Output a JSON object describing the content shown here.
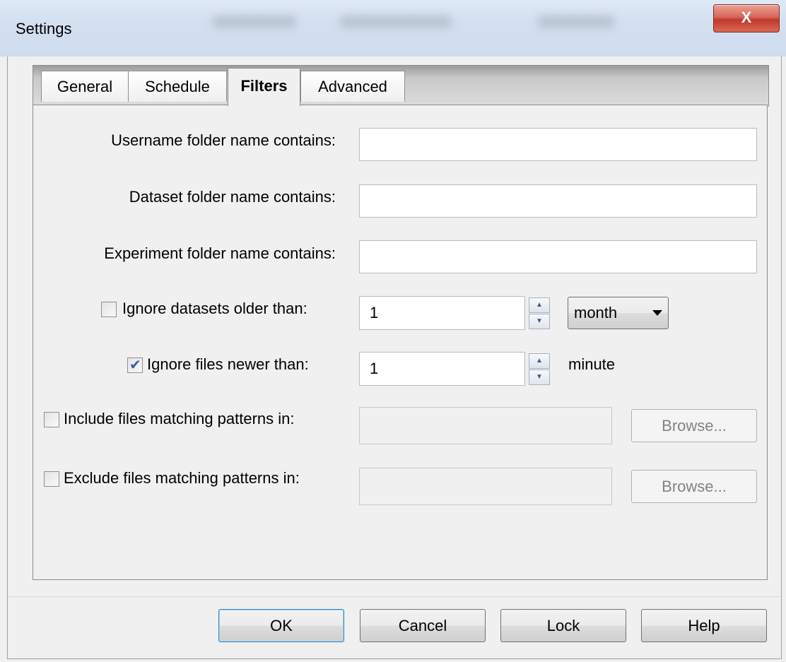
{
  "window": {
    "title": "Settings",
    "close_glyph": "X"
  },
  "tabs": [
    {
      "label": "General",
      "active": false
    },
    {
      "label": "Schedule",
      "active": false
    },
    {
      "label": "Filters",
      "active": true
    },
    {
      "label": "Advanced",
      "active": false
    }
  ],
  "filters": {
    "username_label": "Username folder name contains:",
    "username_value": "",
    "dataset_label": "Dataset folder name contains:",
    "dataset_value": "",
    "experiment_label": "Experiment folder name contains:",
    "experiment_value": "",
    "ignore_older": {
      "label": "Ignore datasets older than:",
      "checked": false,
      "value": "1",
      "unit": "month"
    },
    "ignore_newer": {
      "label": "Ignore files newer than:",
      "checked": true,
      "value": "1",
      "unit": "minute"
    },
    "include_patterns": {
      "label": "Include files matching patterns in:",
      "checked": false,
      "value": "",
      "browse_label": "Browse..."
    },
    "exclude_patterns": {
      "label": "Exclude files matching patterns in:",
      "checked": false,
      "value": "",
      "browse_label": "Browse..."
    }
  },
  "buttons": {
    "ok": "OK",
    "cancel": "Cancel",
    "lock": "Lock",
    "help": "Help"
  }
}
